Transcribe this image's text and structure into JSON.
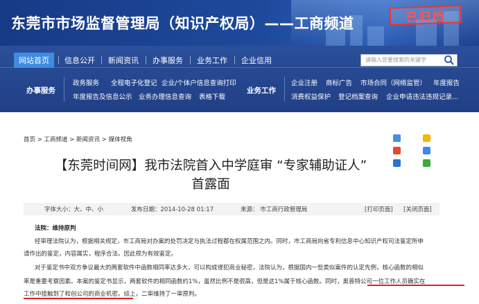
{
  "banner": {
    "title": "东莞市市场监督管理局（知识产权局）——工商频道",
    "archive_stamp": "已归档"
  },
  "nav": {
    "tabs": [
      "网站首页",
      "信息公开",
      "新闻资讯",
      "办事服务",
      "业务工作",
      "企业信用"
    ],
    "search_placeholder": "请输入您要搜索的关键字",
    "left_group_label": "办事服务",
    "left_links_row1": [
      "政务服务",
      "全程电子化登记",
      "企业/个体户信息查询打印"
    ],
    "left_links_row2": [
      "年度报告及信息公示",
      "业务办理信息查询",
      "表格下载"
    ],
    "right_group_label": "业务工作",
    "right_links_row1": [
      "企业注册",
      "商标广告",
      "市场合同（网络监管）",
      "年度报告"
    ],
    "right_links_row2": [
      "消费权益保护",
      "登记档案查询",
      "企业申请违法违规记录..."
    ]
  },
  "content": {
    "breadcrumb": "首页 > 工商频道 > 新闻资讯 > 媒体视角",
    "title_line1": "【东莞时间网】我市法院首入中学庭审 “专家辅助证人”",
    "title_line2": "首露面",
    "font_size_label": "字体大小：大、中、小",
    "publish_time": "发布日期：2014-10-28 01:17",
    "source": "来源：  市工商行政管理局",
    "print_link": "[打印页面]",
    "close_link": "[关闭页面]",
    "para_head": "法院：维持原判",
    "lines": [
      "经审理法院认为，根据相关规定，市工商局对办案的处罚决定与执法过程都在权属范围之内。同时，市工商局向省专利信息中心知识产权司法鉴定所申",
      "请作出的鉴定，内容属实，程序合法。因此视为有效鉴定。",
      "对于鉴定书中双方争议最大的两套软件中函数相同率达多大，可以构成侵犯商业秘密，法院认为，根据国内一些类似案件的认定先例，核心函数的相似",
      "率是重要考察因素。本案的鉴定书显示，两套软件的相同函数约1%，虽然比例不是很高，但是这1%属于核心函数。同时，奥普特公司一位工作人员确实在",
      "工作中接触到了和创公司的商业机密。综上，二审维持了一审原判。"
    ]
  }
}
